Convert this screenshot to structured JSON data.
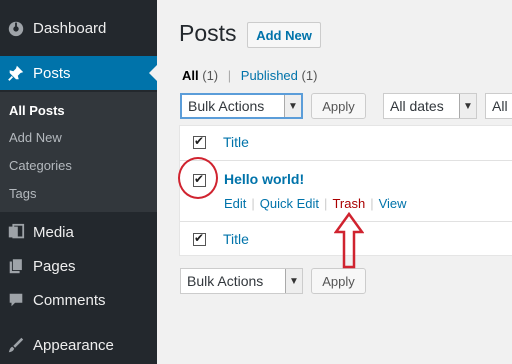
{
  "sidebar": {
    "dashboard": "Dashboard",
    "posts": "Posts",
    "submenu": {
      "all_posts": "All Posts",
      "add_new": "Add New",
      "categories": "Categories",
      "tags": "Tags"
    },
    "media": "Media",
    "pages": "Pages",
    "comments": "Comments",
    "appearance": "Appearance",
    "active_color": "#0073aa"
  },
  "header": {
    "title": "Posts",
    "add_new": "Add New"
  },
  "filters": {
    "all_label": "All",
    "all_count": "(1)",
    "separator": "|",
    "published_label": "Published",
    "published_count": "(1)"
  },
  "top_nav": {
    "bulk_actions": "Bulk Actions",
    "apply": "Apply",
    "dates": "All dates",
    "categories_partial": "All"
  },
  "table": {
    "header_title": "Title",
    "footer_title": "Title",
    "rows": [
      {
        "title": "Hello world!",
        "checked": true,
        "actions": {
          "edit": "Edit",
          "quick_edit": "Quick Edit",
          "trash": "Trash",
          "view": "View"
        },
        "action_sep": "|"
      }
    ]
  },
  "bottom_nav": {
    "bulk_actions": "Bulk Actions",
    "apply": "Apply"
  },
  "annotations": {
    "color": "#d0232f",
    "shapes": [
      "circle-around-checkbox",
      "up-arrow-to-trash"
    ]
  }
}
